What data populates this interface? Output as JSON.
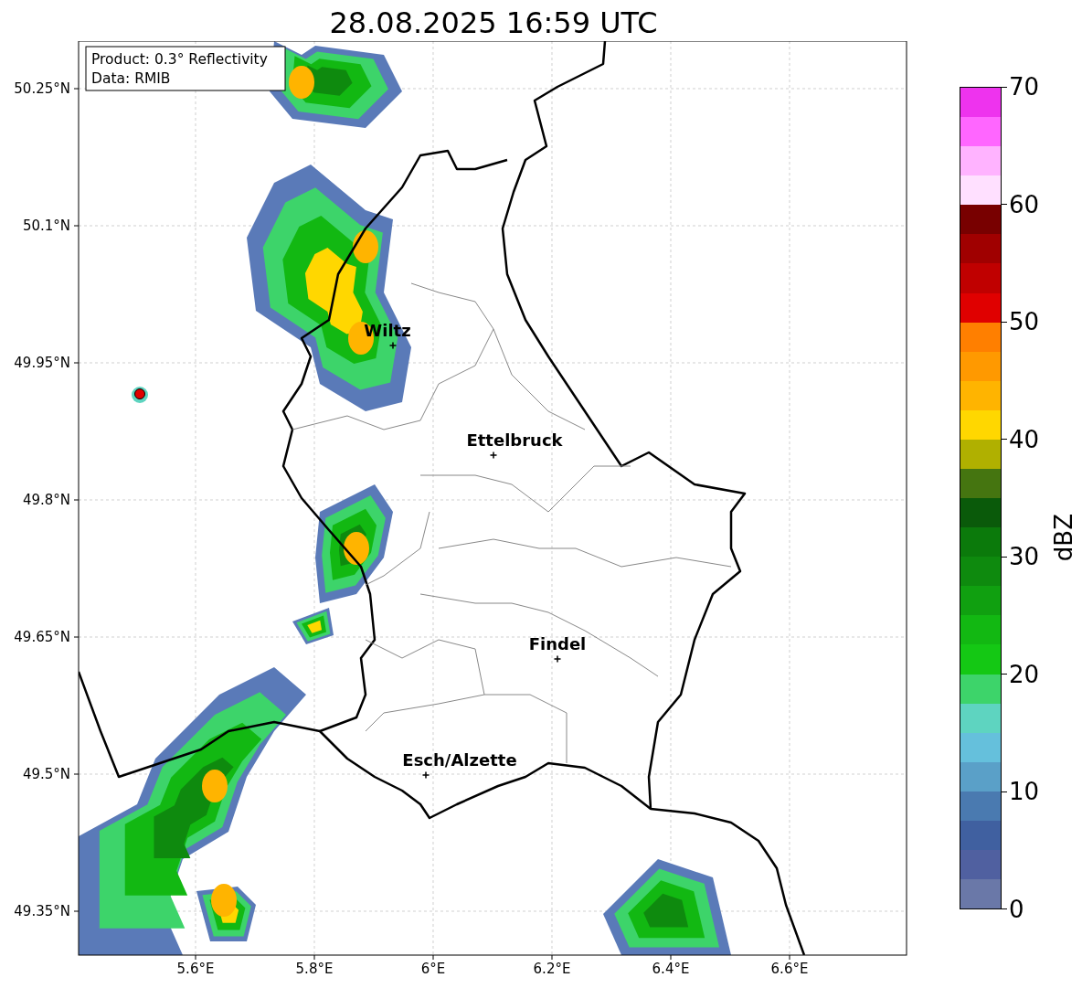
{
  "title": "28.08.2025 16:59 UTC",
  "info_box": [
    "Product: 0.3° Reflectivity",
    "Data: RMIB"
  ],
  "yticks": [
    "50.25°N",
    "50.1°N",
    "49.95°N",
    "49.8°N",
    "49.65°N",
    "49.5°N",
    "49.35°N"
  ],
  "xticks": [
    "5.6°E",
    "5.8°E",
    "6°E",
    "6.2°E",
    "6.4°E",
    "6.6°E"
  ],
  "cities": [
    {
      "name": "Wiltz"
    },
    {
      "name": "Ettelbruck"
    },
    {
      "name": "Findel"
    },
    {
      "name": "Esch/Alzette"
    }
  ],
  "colorbar": {
    "label": "dBZ",
    "ticks": [
      "70",
      "60",
      "50",
      "40",
      "30",
      "20",
      "10",
      "0"
    ],
    "segments": [
      {
        "color": "#ee33ee"
      },
      {
        "color": "#ff66ff"
      },
      {
        "color": "#ffb3ff"
      },
      {
        "color": "#ffe0ff"
      },
      {
        "color": "#780000"
      },
      {
        "color": "#a00000"
      },
      {
        "color": "#c00000"
      },
      {
        "color": "#e00000"
      },
      {
        "color": "#ff7f00"
      },
      {
        "color": "#ff9900"
      },
      {
        "color": "#ffb400"
      },
      {
        "color": "#ffd700"
      },
      {
        "color": "#b0b000"
      },
      {
        "color": "#457510"
      },
      {
        "color": "#0a5a0a"
      },
      {
        "color": "#0b7a0b"
      },
      {
        "color": "#0e8a0e"
      },
      {
        "color": "#10a010"
      },
      {
        "color": "#12b812"
      },
      {
        "color": "#14c814"
      },
      {
        "color": "#3dd46a"
      },
      {
        "color": "#5ed4c0"
      },
      {
        "color": "#65c0dc"
      },
      {
        "color": "#5aa0c8"
      },
      {
        "color": "#4a7ab0"
      },
      {
        "color": "#4060a0"
      },
      {
        "color": "#5060a0"
      },
      {
        "color": "#6a78a8"
      }
    ]
  }
}
